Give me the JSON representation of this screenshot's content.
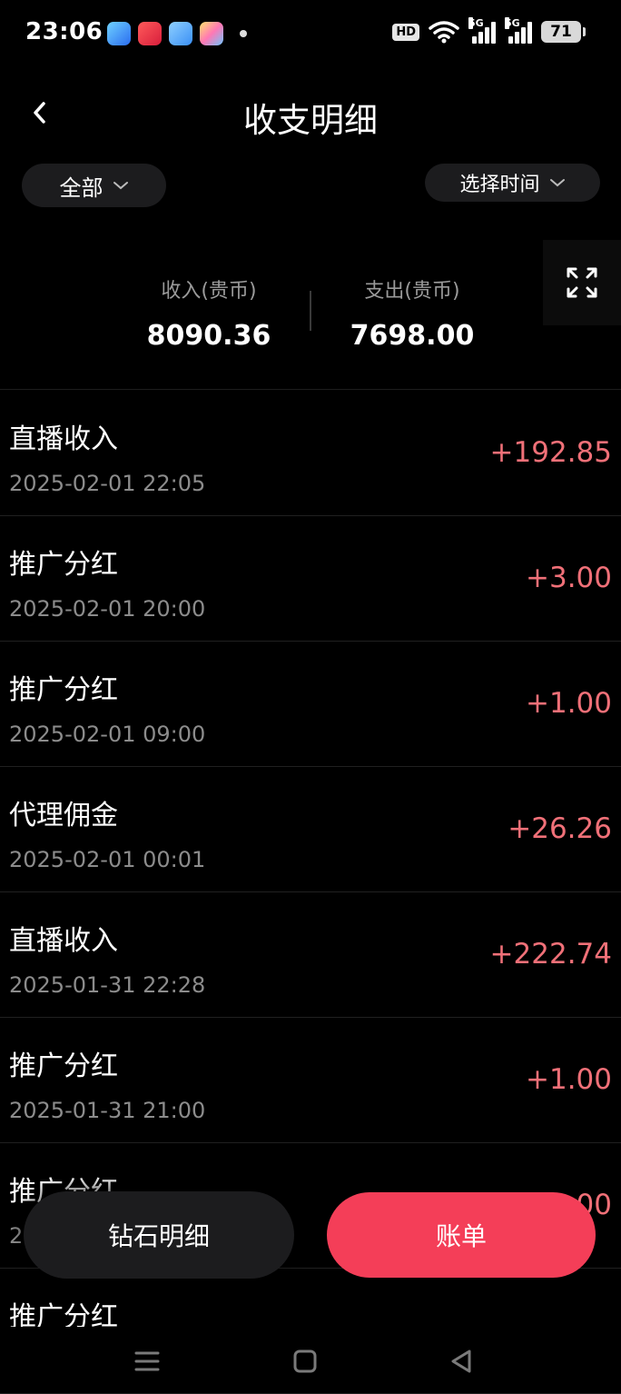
{
  "status_bar": {
    "time": "23:06",
    "hd_badge": "HD",
    "network_1": "5G",
    "network_2": "5G",
    "battery": "71"
  },
  "header": {
    "title": "收支明细"
  },
  "filters": {
    "category": "全部",
    "time": "选择时间"
  },
  "summary": {
    "income_label": "收入(贵币)",
    "income_value": "8090.36",
    "expense_label": "支出(贵币)",
    "expense_value": "7698.00"
  },
  "transactions": [
    {
      "title": "直播收入",
      "time": "2025-02-01 22:05",
      "amount": "+192.85"
    },
    {
      "title": "推广分红",
      "time": "2025-02-01 20:00",
      "amount": "+3.00"
    },
    {
      "title": "推广分红",
      "time": "2025-02-01 09:00",
      "amount": "+1.00"
    },
    {
      "title": "代理佣金",
      "time": "2025-02-01 00:01",
      "amount": "+26.26"
    },
    {
      "title": "直播收入",
      "time": "2025-01-31 22:28",
      "amount": "+222.74"
    },
    {
      "title": "推广分红",
      "time": "2025-01-31 21:00",
      "amount": "+1.00"
    },
    {
      "title": "推广分红",
      "time": "20",
      "amount": "00"
    },
    {
      "title": "推广分红",
      "time": "",
      "amount": ""
    }
  ],
  "bottom_buttons": {
    "diamond_detail": "钻石明细",
    "bill": "账单"
  },
  "colors": {
    "background": "#000000",
    "pill_bg": "#1c1c1e",
    "amount_positive": "#f07078",
    "accent": "#f43e58",
    "muted_text": "#8c8c8c"
  },
  "icons": {
    "back": "chevron-left-icon",
    "dropdown": "chevron-down-icon",
    "expand": "expand-icon",
    "nav_menu": "menu-icon",
    "nav_home": "square-icon",
    "nav_back": "triangle-back-icon"
  }
}
